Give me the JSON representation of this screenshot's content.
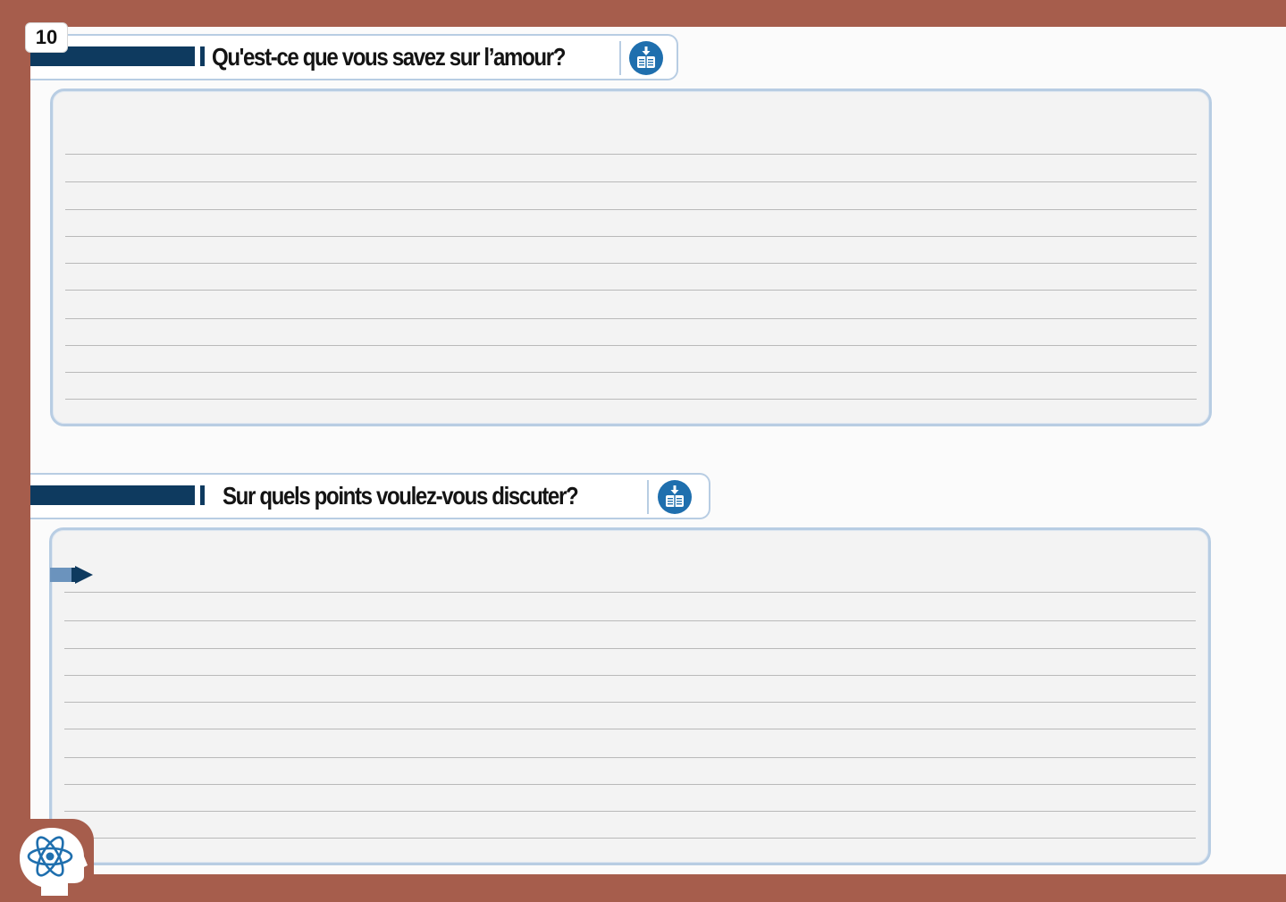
{
  "page": {
    "number": "10"
  },
  "sections": [
    {
      "title": "Qu'est-ce que vous savez sur l’amour?",
      "download_icon": "download-book-icon"
    },
    {
      "title": "Sur quels points voulez-vous discuter?",
      "download_icon": "download-book-icon"
    }
  ],
  "icons": {
    "bullet_marker": "pencil-arrow-icon",
    "brand": "atom-head-logo"
  },
  "colors": {
    "frame": "#a65d4c",
    "heading_bar": "#0e3a5f",
    "box_border": "#b8cde3",
    "icon_blue": "#1f6fae"
  }
}
